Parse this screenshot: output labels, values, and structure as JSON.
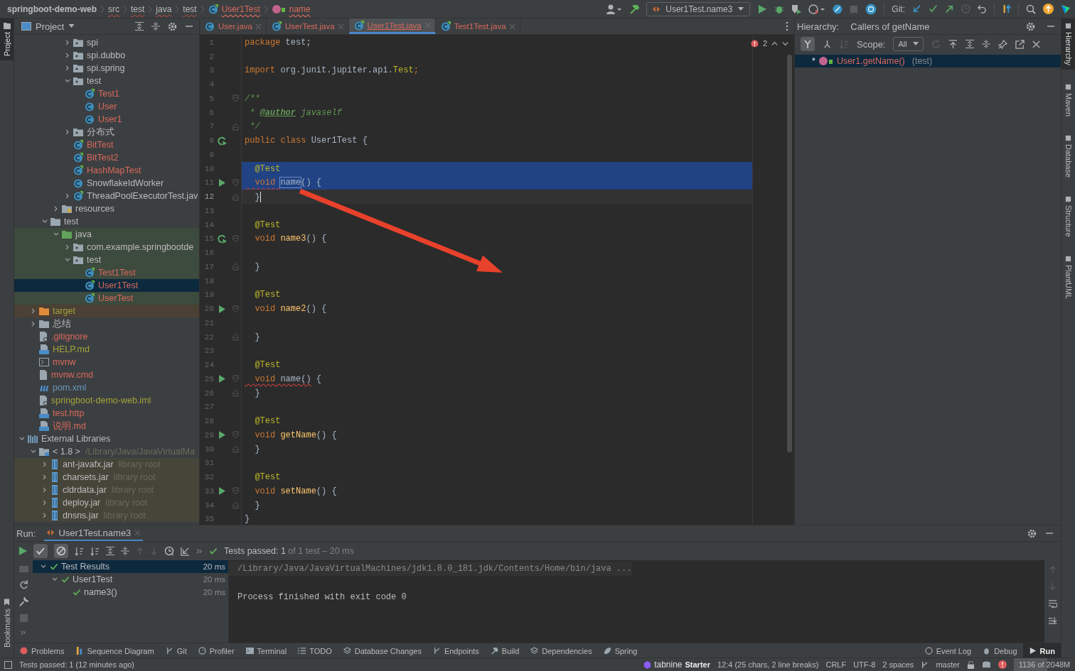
{
  "breadcrumbs": [
    {
      "label": "springboot-demo-web",
      "kind": "project"
    },
    {
      "label": "src",
      "kind": "dir"
    },
    {
      "label": "test",
      "kind": "dir"
    },
    {
      "label": "java",
      "kind": "dir"
    },
    {
      "label": "test",
      "kind": "dir"
    },
    {
      "label": "User1Test",
      "kind": "class"
    },
    {
      "label": "name",
      "kind": "method"
    }
  ],
  "run_config": "User1Test.name3",
  "git_label": "Git:",
  "left_stripe": {
    "top": [
      {
        "label": "Project",
        "selected": true
      }
    ],
    "bottom": [
      {
        "label": "Bookmarks",
        "selected": false
      }
    ]
  },
  "right_stripe": [
    {
      "label": "Hierarchy",
      "selected": true
    },
    {
      "label": "Maven",
      "selected": false
    },
    {
      "label": "Database",
      "selected": false
    },
    {
      "label": "Structure",
      "selected": false
    },
    {
      "label": "PlantUML",
      "selected": false
    }
  ],
  "project_panel": {
    "title": "Project",
    "tree": [
      {
        "children": [
          {
            "children": [
              {
                "children": [
                  {
                    "children": [
                      {
                        "label": "spi",
                        "kind": "package",
                        "color": "#bbbbbb",
                        "expanded": false,
                        "selected": false
                      },
                      {
                        "label": "spi.dubbo",
                        "kind": "package",
                        "color": "#bbbbbb",
                        "expanded": false,
                        "selected": false
                      },
                      {
                        "label": "spi.spring",
                        "kind": "package",
                        "color": "#bbbbbb",
                        "expanded": false,
                        "selected": false
                      },
                      {
                        "label": "test",
                        "kind": "package",
                        "color": "#bbbbbb",
                        "expanded": true,
                        "selected": false,
                        "children": [
                          {
                            "label": "Test1",
                            "kind": "test-class",
                            "color": "#d9695c",
                            "selected": false
                          },
                          {
                            "label": "User",
                            "kind": "class",
                            "color": "#d9695c",
                            "selected": false
                          },
                          {
                            "label": "User1",
                            "kind": "class",
                            "color": "#d9695c",
                            "selected": false
                          }
                        ]
                      },
                      {
                        "label": "分布式",
                        "kind": "package",
                        "color": "#bbbbbb",
                        "expanded": false,
                        "selected": false
                      },
                      {
                        "label": "BitTest",
                        "kind": "test-class",
                        "color": "#d9695c",
                        "selected": false
                      },
                      {
                        "label": "BitTest2",
                        "kind": "test-class",
                        "color": "#d9695c",
                        "selected": false
                      },
                      {
                        "label": "HashMapTest",
                        "kind": "test-class",
                        "color": "#d9695c",
                        "selected": false
                      },
                      {
                        "label": "SnowflakeIdWorker",
                        "kind": "class",
                        "color": "#bbbbbb",
                        "selected": false
                      },
                      {
                        "label": "ThreadPoolExecutorTest.jav",
                        "kind": "test-class",
                        "color": "#bbbbbb",
                        "expanded": false,
                        "selected": false
                      }
                    ]
                  },
                  {
                    "label": "resources",
                    "kind": "resources",
                    "color": "#bbbbbb",
                    "expanded": false,
                    "selected": false
                  }
                ]
              },
              {
                "label": "test",
                "kind": "folder",
                "color": "#bbbbbb",
                "expanded": true,
                "selected": false,
                "children": [
                  {
                    "label": "java",
                    "kind": "test-root",
                    "color": "#bbbbbb",
                    "expanded": true,
                    "selected": false,
                    "band": {
                      "color": "#3d4a3e"
                    },
                    "children": [
                      {
                        "label": "com.example.springbootde",
                        "kind": "package",
                        "color": "#bbbbbb",
                        "expanded": false,
                        "selected": false,
                        "band": {
                          "color": "#3d4a3e"
                        }
                      },
                      {
                        "label": "test",
                        "kind": "package",
                        "color": "#bbbbbb",
                        "expanded": true,
                        "selected": false,
                        "band": {
                          "color": "#3d4a3e"
                        },
                        "children": [
                          {
                            "label": "Test1Test",
                            "kind": "test-class",
                            "color": "#d9695c",
                            "selected": false,
                            "band": {
                              "color": "#3d4a3e"
                            }
                          },
                          {
                            "label": "User1Test",
                            "kind": "test-class",
                            "color": "#d9695c",
                            "selected": true
                          },
                          {
                            "label": "UserTest",
                            "kind": "test-class",
                            "color": "#d9695c",
                            "selected": false,
                            "band": {
                              "color": "#3d4a3e"
                            }
                          }
                        ]
                      }
                    ]
                  }
                ]
              }
            ]
          },
          {
            "label": "target",
            "kind": "excluded",
            "color": "#a3a33a",
            "expanded": false,
            "selected": false,
            "band": {
              "color": "#4a4034"
            }
          },
          {
            "label": "总结",
            "kind": "folder",
            "color": "#bbbbbb",
            "expanded": false,
            "selected": false
          },
          {
            "label": ".gitignore",
            "kind": "ignore-file",
            "color": "#d9695c",
            "selected": false
          },
          {
            "label": "HELP.md",
            "kind": "md-file",
            "color": "#a3a33a",
            "selected": false
          },
          {
            "label": "mvnw",
            "kind": "script-file",
            "color": "#d9695c",
            "selected": false
          },
          {
            "label": "mvnw.cmd",
            "kind": "text-file",
            "color": "#d9695c",
            "selected": false
          },
          {
            "label": "pom.xml",
            "kind": "maven-file",
            "color": "#6897bb",
            "selected": false
          },
          {
            "label": "springboot-demo-web.iml",
            "kind": "module-file",
            "color": "#a3a33a",
            "selected": false
          },
          {
            "label": "test.http",
            "kind": "api-file",
            "color": "#d9695c",
            "selected": false
          },
          {
            "label": "说明.md",
            "kind": "md-file",
            "color": "#d9695c",
            "selected": false
          }
        ]
      },
      {
        "label": "External Libraries",
        "kind": "libraries",
        "color": "#bbbbbb",
        "expanded": true,
        "selected": false,
        "children": [
          {
            "label": "< 1.8 >",
            "suffix": "/Library/Java/JavaVirtualMa",
            "kind": "jdk",
            "color": "#bbbbbb",
            "expanded": true,
            "selected": false,
            "children": [
              {
                "label": "ant-javafx.jar",
                "suffix": "library root",
                "kind": "jar",
                "color": "#bbbbbb",
                "expanded": false,
                "selected": false,
                "band": {
                  "color": "#46453a"
                }
              },
              {
                "label": "charsets.jar",
                "suffix": "library root",
                "kind": "jar",
                "color": "#bbbbbb",
                "expanded": false,
                "selected": false,
                "band": {
                  "color": "#46453a"
                }
              },
              {
                "label": "cldrdata.jar",
                "suffix": "library root",
                "kind": "jar",
                "color": "#bbbbbb",
                "expanded": false,
                "selected": false,
                "band": {
                  "color": "#46453a"
                }
              },
              {
                "label": "deploy.jar",
                "suffix": "library root",
                "kind": "jar",
                "color": "#bbbbbb",
                "expanded": false,
                "selected": false,
                "band": {
                  "color": "#46453a"
                }
              },
              {
                "label": "dnsns.jar",
                "suffix": "library root",
                "kind": "jar",
                "color": "#bbbbbb",
                "expanded": false,
                "selected": false,
                "band": {
                  "color": "#46453a"
                }
              }
            ]
          }
        ]
      }
    ]
  },
  "editor_tabs": [
    {
      "label": "User.java",
      "kind": "class",
      "selected": false
    },
    {
      "label": "UserTest.java",
      "kind": "test-class",
      "selected": false
    },
    {
      "label": "User1Test.java",
      "kind": "test-class",
      "selected": true
    },
    {
      "label": "Test1Test.java",
      "kind": "test-class",
      "selected": false
    }
  ],
  "error_count": "2",
  "editor_lines": [
    {
      "number": "1",
      "tokens": [
        {
          "kind": "kw",
          "s": "package"
        },
        {
          "kind": "plain",
          "s": " test;"
        }
      ]
    },
    {
      "number": "2"
    },
    {
      "number": "3",
      "tokens": [
        {
          "kind": "kw",
          "s": "import"
        },
        {
          "kind": "plain",
          "s": " org.junit.jupiter.api."
        },
        {
          "kind": "annot",
          "s": "Test"
        },
        {
          "kind": "kw",
          "s": ";"
        }
      ]
    },
    {
      "number": "4"
    },
    {
      "number": "5",
      "fold": {
        "kind": "start"
      },
      "tokens": [
        {
          "kind": "comment",
          "s": "/**"
        }
      ]
    },
    {
      "number": "6",
      "tokens": [
        {
          "kind": "comment",
          "s": " * "
        },
        {
          "kind": "doctag",
          "s": "@author"
        },
        {
          "kind": "comment",
          "s": " javaself"
        }
      ]
    },
    {
      "number": "7",
      "fold": {
        "kind": "end"
      },
      "tokens": [
        {
          "kind": "comment",
          "s": " */"
        }
      ]
    },
    {
      "number": "8",
      "gutter": {
        "kind": "rerun"
      },
      "tokens": [
        {
          "kind": "kw",
          "s": "public "
        },
        {
          "kind": "kw",
          "s": "class"
        },
        {
          "kind": "plain",
          "s": " User1Test {"
        }
      ]
    },
    {
      "number": "9"
    },
    {
      "number": "10",
      "highlight": {
        "kind": "selection"
      },
      "tokens": [
        {
          "kind": "annot",
          "s": "  @Test"
        }
      ]
    },
    {
      "number": "11",
      "highlight": {
        "kind": "selection"
      },
      "gutter": {
        "kind": "run"
      },
      "fold": {
        "kind": "start"
      },
      "tokens": [
        {
          "kind": "kw-err",
          "s": "  void "
        },
        {
          "kind": "usage",
          "s": "name"
        },
        {
          "kind": "plain",
          "s": "() {"
        }
      ]
    },
    {
      "number": "12",
      "highlight": {
        "kind": "current"
      },
      "fold": {
        "kind": "end"
      },
      "tokens": [
        {
          "kind": "plain",
          "s": "  }"
        }
      ]
    },
    {
      "number": "13"
    },
    {
      "number": "14",
      "tokens": [
        {
          "kind": "annot",
          "s": "  @Test"
        }
      ]
    },
    {
      "number": "15",
      "gutter": {
        "kind": "rerun"
      },
      "fold": {
        "kind": "start"
      },
      "tokens": [
        {
          "kind": "kw",
          "s": "  void "
        },
        {
          "kind": "method",
          "s": "name3"
        },
        {
          "kind": "plain",
          "s": "() {"
        }
      ]
    },
    {
      "number": "16"
    },
    {
      "number": "17",
      "fold": {
        "kind": "end"
      },
      "tokens": [
        {
          "kind": "plain",
          "s": "  }"
        }
      ]
    },
    {
      "number": "18"
    },
    {
      "number": "19",
      "tokens": [
        {
          "kind": "annot",
          "s": "  @Test"
        }
      ]
    },
    {
      "number": "20",
      "gutter": {
        "kind": "run"
      },
      "fold": {
        "kind": "start"
      },
      "tokens": [
        {
          "kind": "kw",
          "s": "  void "
        },
        {
          "kind": "method",
          "s": "name2"
        },
        {
          "kind": "plain",
          "s": "() {"
        }
      ]
    },
    {
      "number": "21"
    },
    {
      "number": "22",
      "fold": {
        "kind": "end"
      },
      "tokens": [
        {
          "kind": "plain",
          "s": "  }"
        }
      ]
    },
    {
      "number": "23"
    },
    {
      "number": "24",
      "tokens": [
        {
          "kind": "annot",
          "s": "  @Test"
        }
      ]
    },
    {
      "number": "25",
      "gutter": {
        "kind": "run"
      },
      "fold": {
        "kind": "start"
      },
      "tokens": [
        {
          "kind": "kw-err",
          "s": "  void"
        },
        {
          "kind": "err",
          "s": " name()"
        },
        {
          "kind": "plain",
          "s": " {"
        }
      ]
    },
    {
      "number": "26",
      "fold": {
        "kind": "end"
      },
      "tokens": [
        {
          "kind": "plain",
          "s": "  }"
        }
      ]
    },
    {
      "number": "27"
    },
    {
      "number": "28",
      "tokens": [
        {
          "kind": "annot",
          "s": "  @Test"
        }
      ]
    },
    {
      "number": "29",
      "gutter": {
        "kind": "run"
      },
      "fold": {
        "kind": "start"
      },
      "tokens": [
        {
          "kind": "kw",
          "s": "  void "
        },
        {
          "kind": "method",
          "s": "getName"
        },
        {
          "kind": "plain",
          "s": "() {"
        }
      ]
    },
    {
      "number": "30",
      "fold": {
        "kind": "end"
      },
      "tokens": [
        {
          "kind": "plain",
          "s": "  }"
        }
      ]
    },
    {
      "number": "31"
    },
    {
      "number": "32",
      "tokens": [
        {
          "kind": "annot",
          "s": "  @Test"
        }
      ]
    },
    {
      "number": "33",
      "gutter": {
        "kind": "run"
      },
      "fold": {
        "kind": "start"
      },
      "tokens": [
        {
          "kind": "kw",
          "s": "  void "
        },
        {
          "kind": "method",
          "s": "setName"
        },
        {
          "kind": "plain",
          "s": "() {"
        }
      ]
    },
    {
      "number": "34",
      "fold": {
        "kind": "end"
      },
      "tokens": [
        {
          "kind": "plain",
          "s": "  }"
        }
      ]
    },
    {
      "number": "35",
      "tokens": [
        {
          "kind": "plain",
          "s": "}"
        }
      ]
    }
  ],
  "hierarchy": {
    "label": "Hierarchy:",
    "title": "Callers of getName",
    "scope_label": "Scope:",
    "scope_value": "All",
    "results": [
      {
        "marker": "*",
        "label": "User1.getName()",
        "location": "(test)",
        "selected": true
      }
    ]
  },
  "run_panel": {
    "label": "Run:",
    "tab": "User1Test.name3",
    "status": "Tests passed: 1",
    "status_detail": " of 1 test – 20 ms",
    "results": [
      {
        "label": "Test Results",
        "time": "20 ms",
        "selected": true,
        "expanded": true,
        "children": [
          {
            "label": "User1Test",
            "time": "20 ms",
            "selected": false,
            "expanded": true,
            "children": [
              {
                "label": "name3()",
                "time": "20 ms",
                "selected": false
              }
            ]
          }
        ]
      }
    ],
    "console": [
      {
        "kind": "command",
        "text": "/Library/Java/JavaVirtualMachines/jdk1.8.0_181.jdk/Contents/Home/bin/java ..."
      },
      {
        "kind": "output",
        "text": "Process finished with exit code 0"
      }
    ]
  },
  "tool_windows": [
    {
      "label": "Problems",
      "kind": "problems",
      "selected": false
    },
    {
      "label": "Sequence Diagram",
      "kind": "sequence",
      "selected": false
    },
    {
      "label": "Git",
      "kind": "git",
      "selected": false
    },
    {
      "label": "Profiler",
      "kind": "profiler",
      "selected": false
    },
    {
      "label": "Terminal",
      "kind": "terminal",
      "selected": false
    },
    {
      "label": "TODO",
      "kind": "todo",
      "selected": false
    },
    {
      "label": "Database Changes",
      "kind": "database",
      "selected": false
    },
    {
      "label": "Endpoints",
      "kind": "endpoints",
      "selected": false
    },
    {
      "label": "Build",
      "kind": "build",
      "selected": false
    },
    {
      "label": "Dependencies",
      "kind": "dependencies",
      "selected": false
    },
    {
      "label": "Spring",
      "kind": "spring",
      "selected": false
    }
  ],
  "tool_windows_right": [
    {
      "label": "Event Log",
      "kind": "event",
      "selected": false
    },
    {
      "label": "Debug",
      "kind": "debug",
      "selected": false
    },
    {
      "label": "Run",
      "kind": "run",
      "selected": true
    }
  ],
  "status_bar": {
    "message": "Tests passed: 1 (12 minutes ago)",
    "brand": "tabnine",
    "plan": "Starter",
    "position": "12:4 (25 chars, 2 line breaks)",
    "line_separator": "CRLF",
    "encoding": "UTF-8",
    "indent": "2 spaces",
    "branch": "master",
    "memory": {
      "text": "1136 of 2048M",
      "level": 0.55
    }
  }
}
